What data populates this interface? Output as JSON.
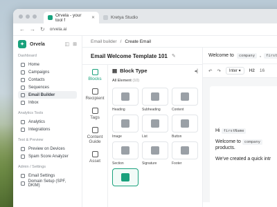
{
  "browser": {
    "tabs": [
      {
        "label": "Orvela - your tool f",
        "active": true
      },
      {
        "label": "Kretya Studio",
        "active": false
      }
    ],
    "url": "orvela.ai"
  },
  "sidebar": {
    "brand": "Orvela",
    "sections": [
      {
        "title": "Dashboard",
        "items": [
          "Home",
          "Campaigns",
          "Contacts",
          "Sequences",
          "Email Builder",
          "Inbox"
        ]
      },
      {
        "title": "Analytics Tools",
        "items": [
          "Analytics",
          "Integrations"
        ]
      },
      {
        "title": "Test & Preview",
        "items": [
          "Preview on Devices",
          "Spam Score Analyzer"
        ]
      },
      {
        "title": "Admin / Settings",
        "items": [
          "Email Settings",
          "Domain Setup (SPF, DKIM)"
        ]
      }
    ],
    "active_item": "Email Builder"
  },
  "breadcrumb": {
    "parent": "Email builder",
    "separator": "/",
    "current": "Create Email"
  },
  "editor": {
    "template_title": "Email Welcome Template 101",
    "rail": [
      "Blocks",
      "Recipient",
      "Tags",
      "Content Guide",
      "Asset"
    ],
    "rail_active": "Blocks",
    "block_panel": {
      "title": "Block Type",
      "filter_label": "All Element",
      "filter_count": "(10)",
      "blocks": [
        "Heading",
        "Subheading",
        "Content",
        "Image",
        "List",
        "Button",
        "Section",
        "Signature",
        "Footer",
        ""
      ]
    }
  },
  "preview": {
    "subject_prefix": "Welcome to",
    "subject_tokens": [
      "company",
      "firstNa"
    ],
    "toolbar": {
      "font": "Inter",
      "heading": "H2",
      "size": "16"
    },
    "body": {
      "greeting": "Hi",
      "greeting_token": "firstName",
      "line2_prefix": "Welcome to",
      "line2_token": "company",
      "line3": "products.",
      "line4": "We've created a quick intr"
    }
  },
  "colors": {
    "accent": "#19a17c"
  }
}
